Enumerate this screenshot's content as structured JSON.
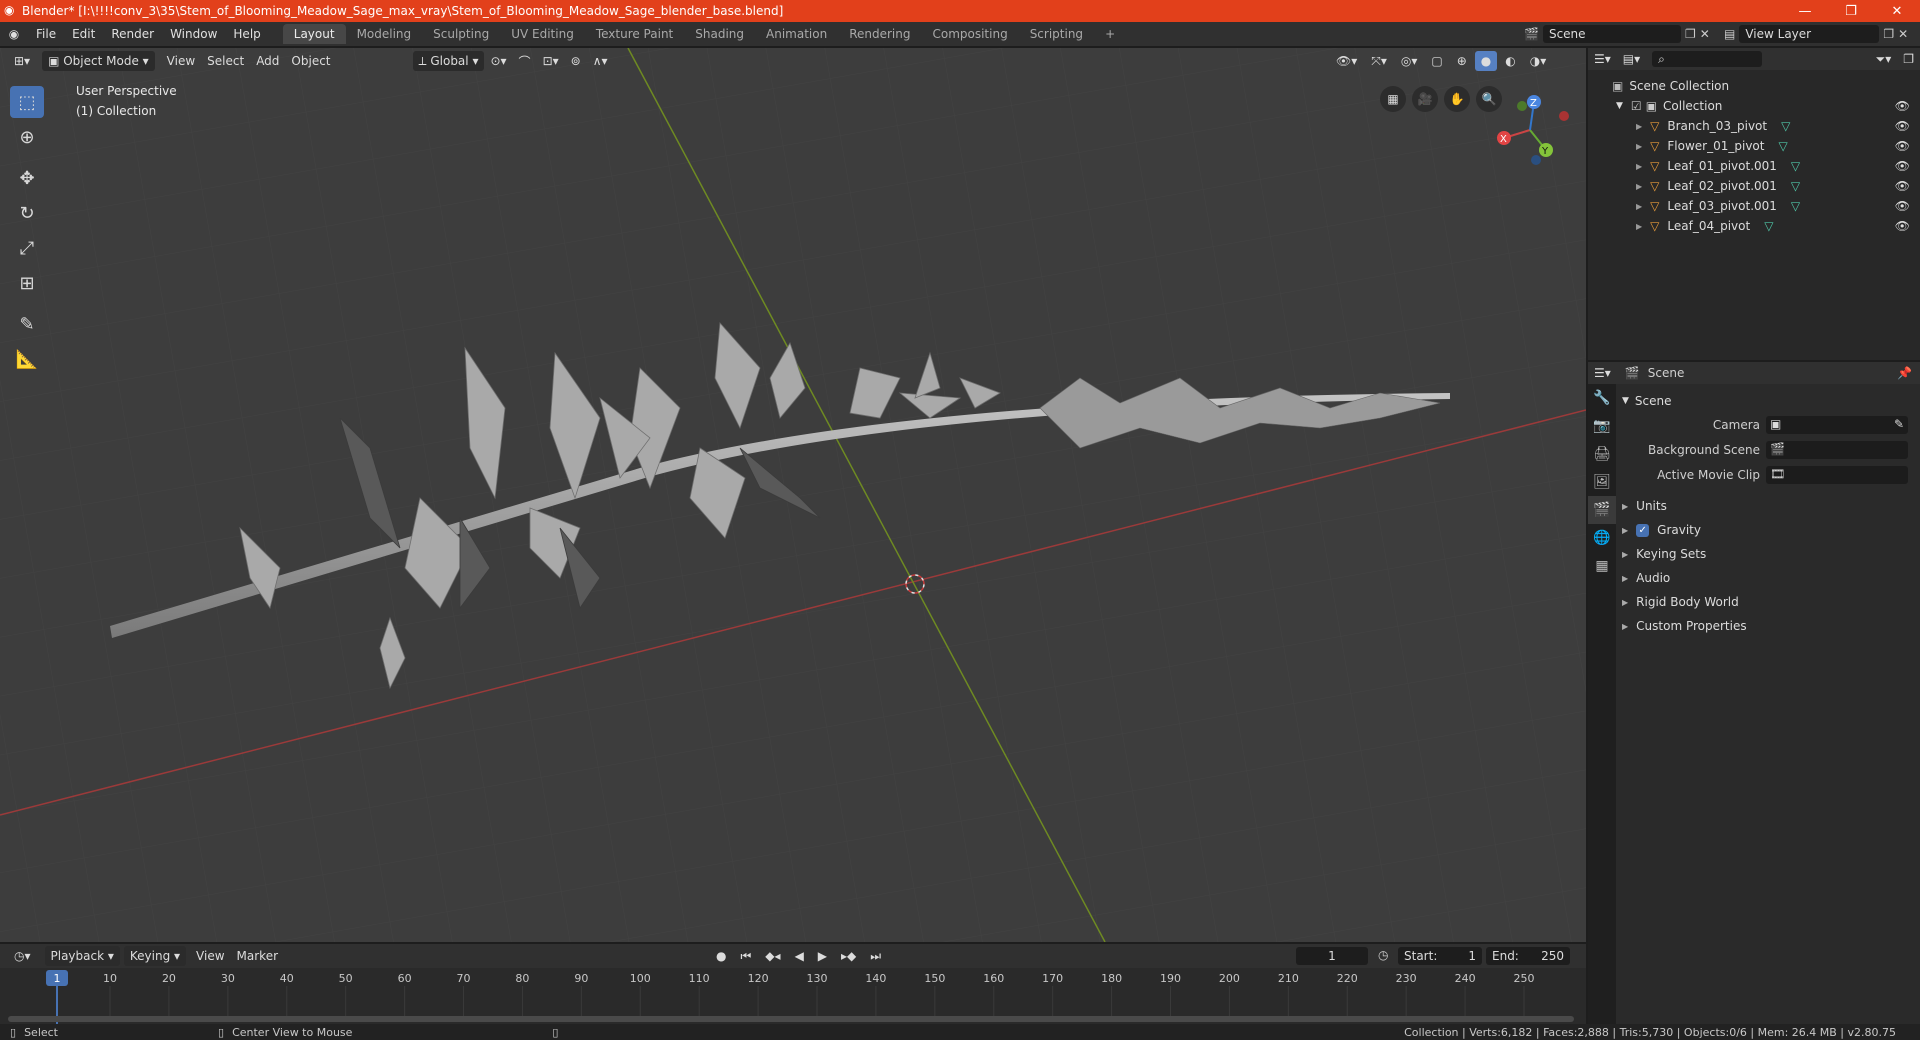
{
  "window": {
    "title": "Blender* [I:\\!!!!conv_3\\35\\Stem_of_Blooming_Meadow_Sage_max_vray\\Stem_of_Blooming_Meadow_Sage_blender_base.blend]",
    "accent": "#e2401b"
  },
  "menus": [
    "File",
    "Edit",
    "Render",
    "Window",
    "Help"
  ],
  "workspaces": [
    "Layout",
    "Modeling",
    "Sculpting",
    "UV Editing",
    "Texture Paint",
    "Shading",
    "Animation",
    "Rendering",
    "Compositing",
    "Scripting"
  ],
  "workspace_add": "+",
  "scene_field": "Scene",
  "view_layer_field": "View Layer",
  "viewport": {
    "mode": "Object Mode",
    "menu": [
      "View",
      "Select",
      "Add",
      "Object"
    ],
    "orientation": "Global",
    "perspective_label": "User Perspective",
    "collection_label": "(1) Collection",
    "gizmo": {
      "x": "X",
      "y": "Y",
      "z": "Z"
    }
  },
  "outliner": {
    "root": "Scene Collection",
    "collection": "Collection",
    "objects": [
      "Branch_03_pivot",
      "Flower_01_pivot",
      "Leaf_01_pivot.001",
      "Leaf_02_pivot.001",
      "Leaf_03_pivot.001",
      "Leaf_04_pivot"
    ]
  },
  "properties": {
    "header": "Scene",
    "section": "Scene",
    "camera_label": "Camera",
    "background_label": "Background Scene",
    "movieclip_label": "Active Movie Clip",
    "panels": [
      "Units",
      "Gravity",
      "Keying Sets",
      "Audio",
      "Rigid Body World",
      "Custom Properties"
    ],
    "gravity_checked": true
  },
  "timeline": {
    "menus": [
      "Playback",
      "Keying",
      "View",
      "Marker"
    ],
    "current_frame": "1",
    "start_label": "Start:",
    "start": "1",
    "end_label": "End:",
    "end": "250",
    "ticks": [
      "1",
      "10",
      "20",
      "30",
      "40",
      "50",
      "60",
      "70",
      "80",
      "90",
      "100",
      "110",
      "120",
      "130",
      "140",
      "150",
      "160",
      "170",
      "180",
      "190",
      "200",
      "210",
      "220",
      "230",
      "240",
      "250"
    ]
  },
  "statusbar": {
    "select": "Select",
    "center_view": "Center View to Mouse",
    "stats": "Collection | Verts:6,182 | Faces:2,888 | Tris:5,730 | Objects:0/6 | Mem: 26.4 MB | v2.80.75"
  }
}
